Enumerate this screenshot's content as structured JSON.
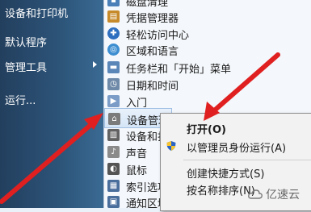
{
  "start_menu": {
    "items": [
      {
        "label": "设备和打印机"
      },
      {
        "label": "默认程序"
      },
      {
        "label": "管理工具"
      },
      {
        "label": "运行..."
      }
    ]
  },
  "admin_tools": {
    "items": [
      {
        "label": "磁盘清理",
        "icon": "disk-cleanup-icon",
        "color": "#4a7fb8"
      },
      {
        "label": "凭据管理器",
        "icon": "credential-manager-icon",
        "color": "#c68a2a"
      },
      {
        "label": "轻松访问中心",
        "icon": "ease-of-access-icon",
        "color": "#2f6fbf"
      },
      {
        "label": "区域和语言",
        "icon": "globe-icon",
        "color": "#3d8ed1"
      },
      {
        "label": "任务栏和「开始」菜单",
        "icon": "taskbar-icon",
        "color": "#5a86b8"
      },
      {
        "label": "日期和时间",
        "icon": "clock-icon",
        "color": "#6f8aa8"
      },
      {
        "label": "入门",
        "icon": "getting-started-icon",
        "color": "#7a9cc7"
      },
      {
        "label": "设备管理器",
        "icon": "device-manager-icon",
        "color": "#7b7b7b"
      },
      {
        "label": "设备和打印机",
        "icon": "printer-icon",
        "color": "#626262"
      },
      {
        "label": "声音",
        "icon": "speaker-icon",
        "color": "#8a8a8a"
      },
      {
        "label": "鼠标",
        "icon": "mouse-icon",
        "color": "#555555"
      },
      {
        "label": "索引选项",
        "icon": "index-icon",
        "color": "#4a6e9c"
      },
      {
        "label": "通知区域图标",
        "icon": "notification-area-icon",
        "color": "#4a6e9c"
      }
    ]
  },
  "context_menu": {
    "items": [
      {
        "label": "打开(O)",
        "bold": true
      },
      {
        "label": "以管理员身份运行(A)",
        "icon": "uac-shield-icon"
      },
      {
        "label": "创建快捷方式(S)"
      },
      {
        "label": "按名称排序(N)"
      }
    ]
  },
  "watermark": {
    "text": "亿速云"
  },
  "colors": {
    "accent_arrow": "#e02020"
  }
}
